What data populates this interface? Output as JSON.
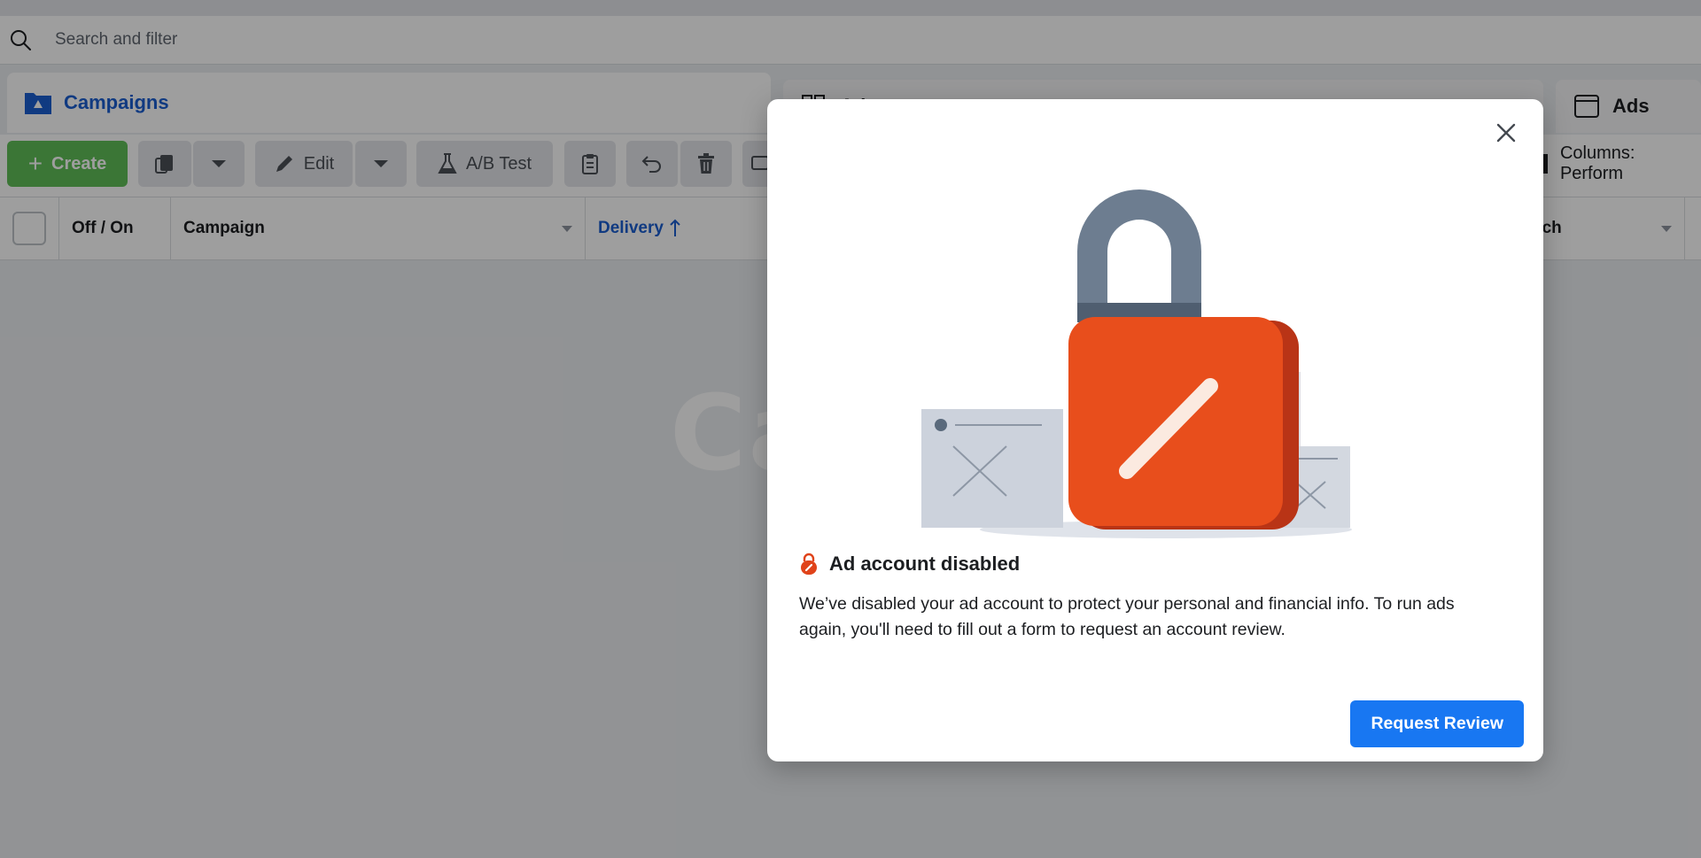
{
  "search": {
    "placeholder": "Search and filter"
  },
  "tabs": {
    "campaigns": "Campaigns",
    "adsets": "Ad sets",
    "ads": "Ads"
  },
  "toolbar": {
    "create_label": "Create",
    "edit_label": "Edit",
    "ab_test_label": "A/B Test",
    "columns_label": "Columns: Perform"
  },
  "table": {
    "headers": {
      "off_on": "Off / On",
      "campaign": "Campaign",
      "delivery": "Delivery",
      "reach": "ach"
    }
  },
  "watermark": "Ca    eh",
  "modal": {
    "title": "Ad account disabled",
    "body": "We’ve disabled your ad account to protect your personal and financial info. To run ads again, you'll need to fill out a form to request an account review.",
    "primary_button": "Request Review",
    "close_icon": "close-icon",
    "illustration": "padlock-illustration"
  },
  "colors": {
    "accent": "#1877f2",
    "tab_active_text": "#1a5ed1",
    "create_green": "#5fbf58",
    "lock_orange": "#e84e1c",
    "lock_shackle": "#5a6a7c"
  }
}
